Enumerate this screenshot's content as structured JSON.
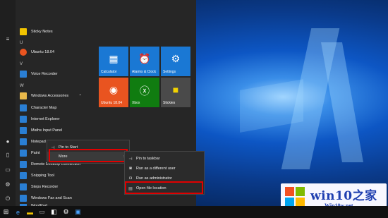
{
  "start_menu": {
    "apps": [
      {
        "label": "Sticky Notes",
        "icon": "sticky-notes-icon"
      },
      {
        "label": "U",
        "type": "letter"
      },
      {
        "label": "Ubuntu 18.04",
        "icon": "ubuntu-icon"
      },
      {
        "label": "V",
        "type": "letter"
      },
      {
        "label": "Voice Recorder",
        "icon": "microphone-icon"
      },
      {
        "label": "W",
        "type": "letter"
      },
      {
        "label": "Windows Accessories",
        "icon": "folder-icon"
      },
      {
        "label": "Character Map",
        "icon": "character-map-icon"
      },
      {
        "label": "Internet Explorer",
        "icon": "internet-explorer-icon"
      },
      {
        "label": "Maths Input Panel",
        "icon": "maths-input-icon"
      },
      {
        "label": "Notepad",
        "icon": "notepad-icon"
      },
      {
        "label": "Paint",
        "icon": "paint-icon"
      },
      {
        "label": "Remote Desktop Connection",
        "icon": "remote-desktop-icon"
      },
      {
        "label": "Snipping Tool",
        "icon": "snipping-tool-icon"
      },
      {
        "label": "Steps Recorder",
        "icon": "steps-recorder-icon"
      },
      {
        "label": "Windows Fax and Scan",
        "icon": "fax-icon"
      },
      {
        "label": "WordPad",
        "icon": "wordpad-icon"
      }
    ],
    "tiles": [
      {
        "label": "Calculator",
        "icon": "calculator-icon",
        "color": "#1a78d4"
      },
      {
        "label": "Alarms & Clock",
        "icon": "alarm-clock-icon",
        "color": "#1a78d4"
      },
      {
        "label": "Settings",
        "icon": "gear-icon",
        "color": "#1a78d4"
      },
      {
        "label": "Ubuntu 18.04",
        "icon": "ubuntu-icon",
        "color": "#e95420"
      },
      {
        "label": "Xbox",
        "icon": "xbox-icon",
        "color": "#107c10"
      },
      {
        "label": "Stickies",
        "icon": "sticky-note-icon",
        "color": "#4a4a4a"
      }
    ]
  },
  "context_menu": {
    "pin_to_start": "Pin to Start",
    "more": "More"
  },
  "submenu": {
    "pin_to_taskbar": "Pin to taskbar",
    "run_as_different_user": "Run as a different user",
    "run_as_administrator": "Run as administrator",
    "open_file_location": "Open file location"
  },
  "watermark": {
    "title": "win10之家",
    "url": "Win10w.net"
  },
  "colors": {
    "highlight": "#e00000",
    "menu_bg": "#262626",
    "accent": "#1a78d4"
  }
}
